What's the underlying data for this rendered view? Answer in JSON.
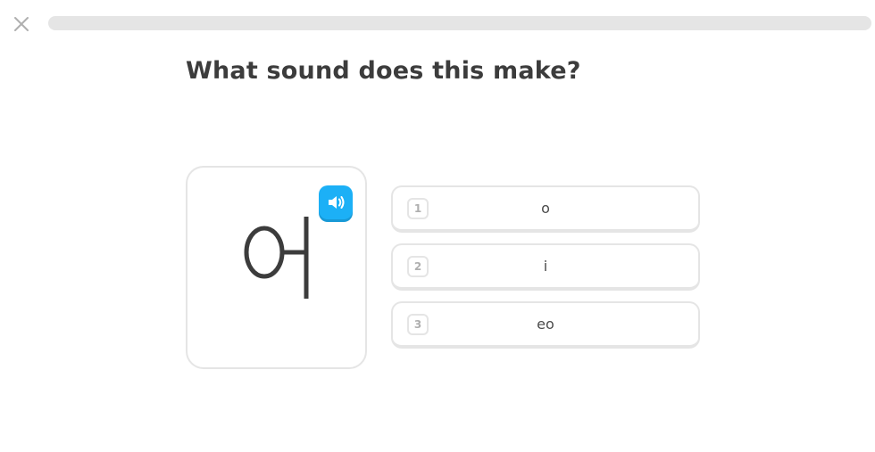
{
  "header": {
    "close_icon": "close-icon",
    "progress": 0
  },
  "question": {
    "title": "What sound does this make?"
  },
  "character_card": {
    "glyph": "어",
    "speaker_icon": "speaker-icon",
    "speaker_color": "#1cb0f6"
  },
  "options": [
    {
      "number": "1",
      "label": "o"
    },
    {
      "number": "2",
      "label": "i"
    },
    {
      "number": "3",
      "label": "eo"
    }
  ]
}
